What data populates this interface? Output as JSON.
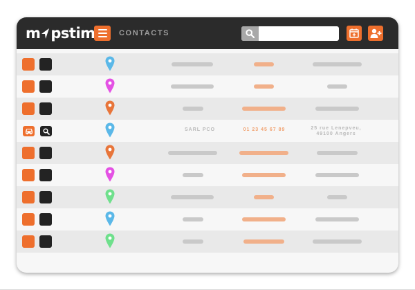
{
  "header": {
    "logo_text_left": "m",
    "logo_text_right": "pstime",
    "title": "CONTACTS",
    "search": {
      "value": "",
      "placeholder": ""
    },
    "icons": [
      "menu-icon",
      "search-icon",
      "calendar-add-icon",
      "user-add-icon"
    ]
  },
  "colors": {
    "accent": "#ee6f2d",
    "topbar": "#2b2b2b",
    "pin_blue": "#5bb8e8",
    "pin_magenta": "#e452e4",
    "pin_orange": "#e8753a",
    "pin_green": "#6fe08c",
    "placeholder_gray": "#c9c9c9",
    "placeholder_peach": "#f1b08a"
  },
  "contacts": [
    {
      "pin_color": "#5bb8e8"
    },
    {
      "pin_color": "#e452e4"
    },
    {
      "pin_color": "#e8753a"
    },
    {
      "pin_color": "#5bb8e8",
      "name": "SARL PCO",
      "phone": "01 23 45 67 89",
      "address_line1": "25 rue Lenepveu,",
      "address_line2": "49100 Angers",
      "action_icons": [
        "car-icon",
        "search-icon"
      ]
    },
    {
      "pin_color": "#e8753a"
    },
    {
      "pin_color": "#e452e4"
    },
    {
      "pin_color": "#6fe08c"
    },
    {
      "pin_color": "#5bb8e8"
    },
    {
      "pin_color": "#6fe08c"
    }
  ]
}
